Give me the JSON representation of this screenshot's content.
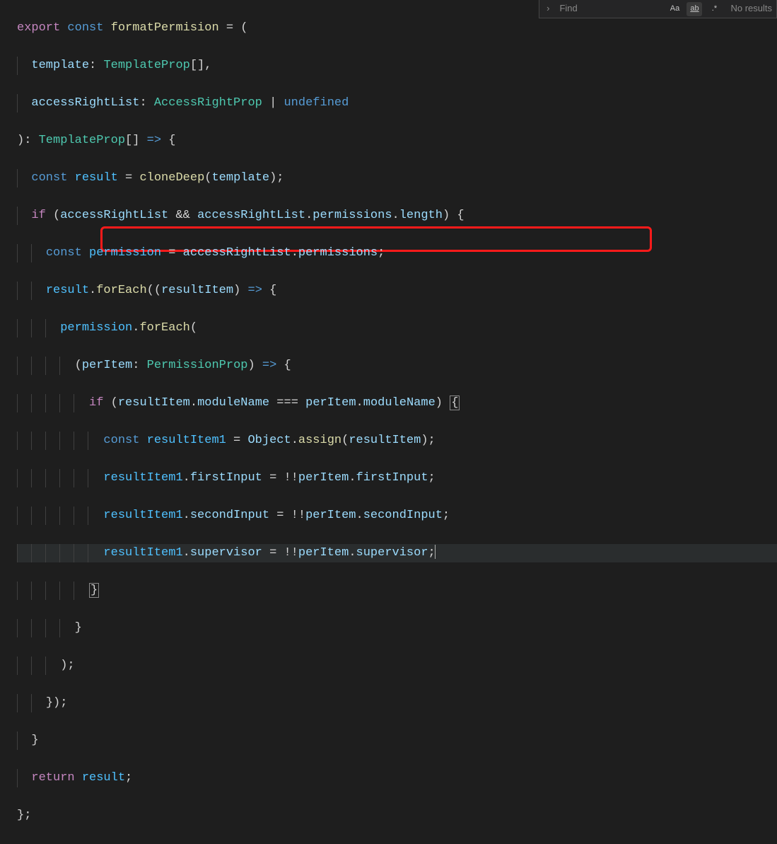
{
  "find": {
    "chevron": "›",
    "placeholder": "Find",
    "caseLabel": "Aa",
    "wordLabel": "ab",
    "regexLabel": ".*",
    "results": "No results"
  },
  "code": {
    "l1": {
      "export": "export",
      "const": "const",
      "name": "formatPermision",
      "eq": " = ("
    },
    "l2": {
      "p": "template",
      "colon": ": ",
      "type": "TemplateProp",
      "arr": "[]",
      "comma": ","
    },
    "l3": {
      "p": "accessRightList",
      "colon": ": ",
      "type": "AccessRightProp",
      "pipe": " | ",
      "undef": "undefined"
    },
    "l4": {
      "close": "): ",
      "type": "TemplateProp",
      "arr": "[] ",
      "arrow": "=>",
      "brace": " {"
    },
    "l5": {
      "const": "const",
      "v": "result",
      "eq": " = ",
      "fn": "cloneDeep",
      "open": "(",
      "arg": "template",
      "close": ");"
    },
    "l6": {
      "if": "if",
      "open": " (",
      "a": "accessRightList",
      "and": " && ",
      "b": "accessRightList",
      "dot1": ".",
      "p1": "permissions",
      "dot2": ".",
      "p2": "length",
      "close": ") {"
    },
    "l7": {
      "const": "const",
      "v": "permission",
      "eq": " = ",
      "a": "accessRightList",
      "dot": ".",
      "p": "permissions",
      "semi": ";"
    },
    "l8": {
      "a": "result",
      "dot": ".",
      "fn": "forEach",
      "open": "((",
      "p": "resultItem",
      "close": ") ",
      "arrow": "=>",
      "brace": " {"
    },
    "l9": {
      "a": "permission",
      "dot": ".",
      "fn": "forEach",
      "open": "("
    },
    "l10": {
      "open": "(",
      "p": "perItem",
      "colon": ": ",
      "type": "PermissionProp",
      "close": ") ",
      "arrow": "=>",
      "brace": " {"
    },
    "l11": {
      "if": "if",
      "open": " (",
      "a": "resultItem",
      "d1": ".",
      "p1": "moduleName",
      "eq": " === ",
      "b": "perItem",
      "d2": ".",
      "p2": "moduleName",
      "close": ") ",
      "brace": "{"
    },
    "l12": {
      "const": "const",
      "v": "resultItem1",
      "eq": " = ",
      "obj": "Object",
      "dot": ".",
      "fn": "assign",
      "open": "(",
      "arg": "resultItem",
      "close": ");"
    },
    "l13": {
      "a": "resultItem1",
      "d": ".",
      "p": "firstInput",
      "eq": " = !!",
      "b": "perItem",
      "d2": ".",
      "p2": "firstInput",
      "semi": ";"
    },
    "l14": {
      "a": "resultItem1",
      "d": ".",
      "p": "secondInput",
      "eq": " = !!",
      "b": "perItem",
      "d2": ".",
      "p2": "secondInput",
      "semi": ";"
    },
    "l15": {
      "a": "resultItem1",
      "d": ".",
      "p": "supervisor",
      "eq": " = !!",
      "b": "perItem",
      "d2": ".",
      "p2": "supervisor",
      "semi": ";"
    },
    "l16": {
      "brace": "}"
    },
    "l17": {
      "brace": "}"
    },
    "l18": {
      "close": ");"
    },
    "l19": {
      "close": "});"
    },
    "l20": {
      "brace": "}"
    },
    "l21": {
      "return": "return",
      "sp": " ",
      "v": "result",
      "semi": ";"
    },
    "l22": {
      "close": "};"
    }
  }
}
